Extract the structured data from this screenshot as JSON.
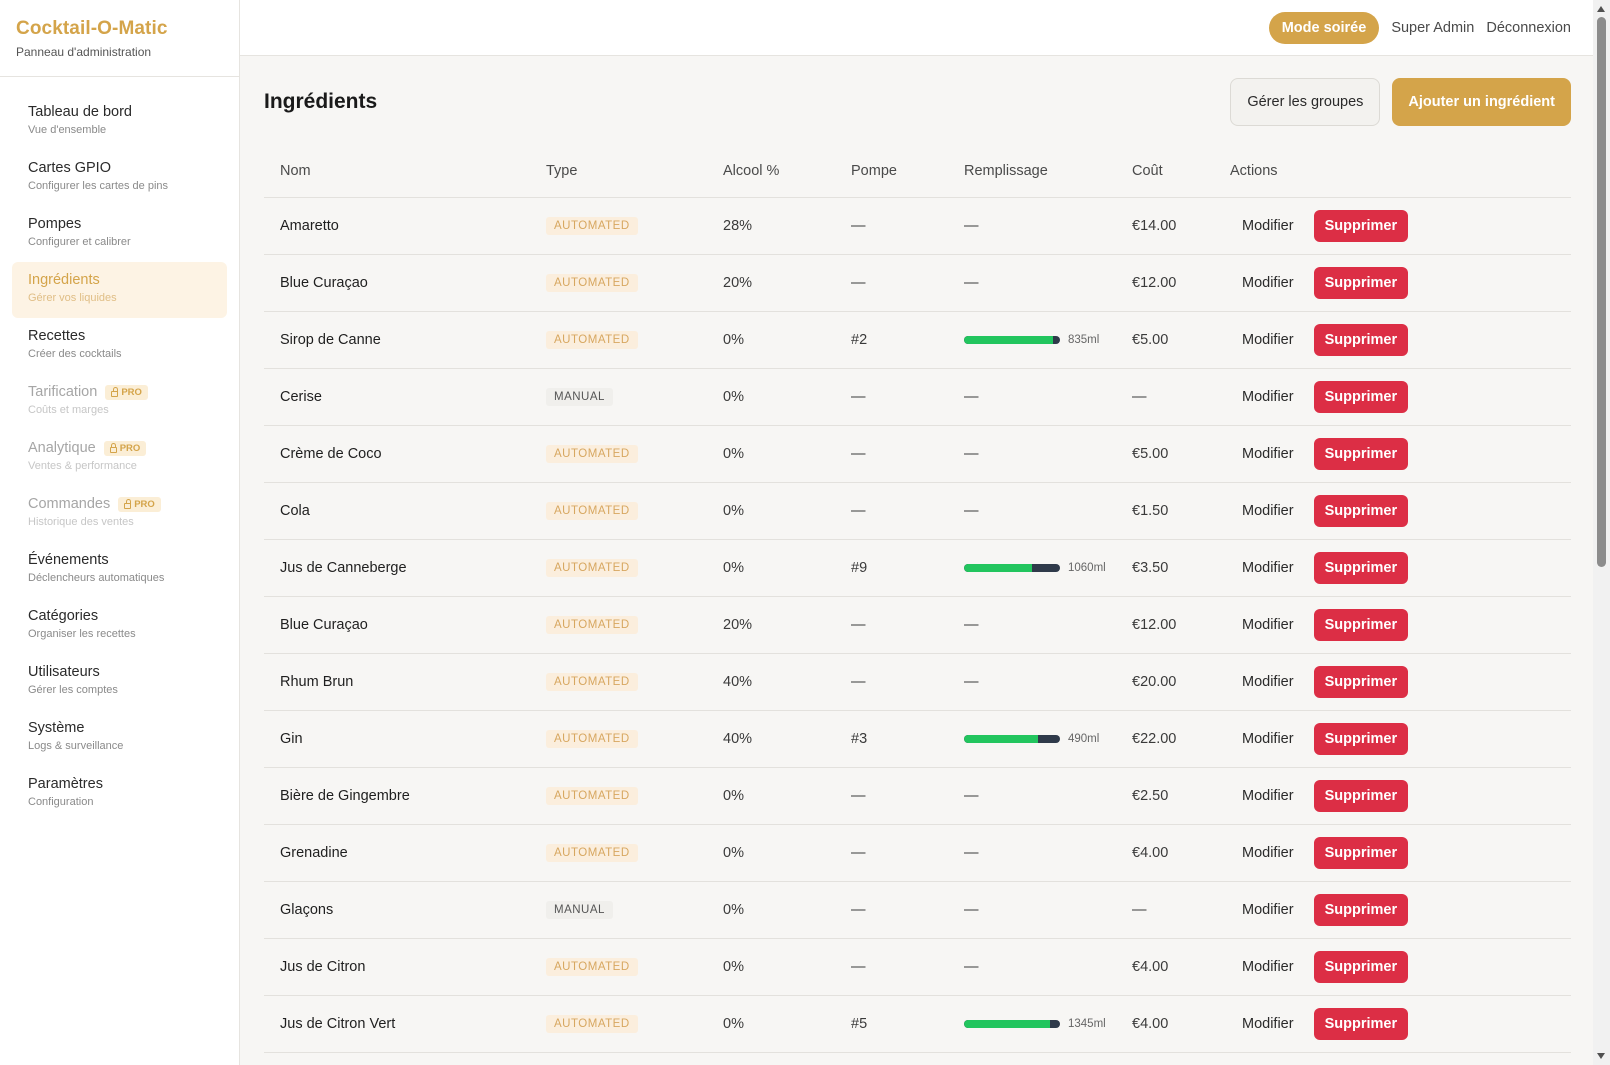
{
  "brand": {
    "title": "Cocktail-O-Matic",
    "subtitle": "Panneau d'administration"
  },
  "topbar": {
    "mode_label": "Mode soirée",
    "user_label": "Super Admin",
    "logout_label": "Déconnexion"
  },
  "sidebar": {
    "items": [
      {
        "label": "Tableau de bord",
        "sub": "Vue d'ensemble"
      },
      {
        "label": "Cartes GPIO",
        "sub": "Configurer les cartes de pins"
      },
      {
        "label": "Pompes",
        "sub": "Configurer et calibrer"
      },
      {
        "label": "Ingrédients",
        "sub": "Gérer vos liquides"
      },
      {
        "label": "Recettes",
        "sub": "Créer des cocktails"
      },
      {
        "label": "Tarification",
        "sub": "Coûts et marges",
        "badge": "PRO"
      },
      {
        "label": "Analytique",
        "sub": "Ventes & performance",
        "badge": "PRO"
      },
      {
        "label": "Commandes",
        "sub": "Historique des ventes",
        "badge": "PRO"
      },
      {
        "label": "Événements",
        "sub": "Déclencheurs automatiques"
      },
      {
        "label": "Catégories",
        "sub": "Organiser les recettes"
      },
      {
        "label": "Utilisateurs",
        "sub": "Gérer les comptes"
      },
      {
        "label": "Système",
        "sub": "Logs & surveillance"
      },
      {
        "label": "Paramètres",
        "sub": "Configuration"
      }
    ]
  },
  "page": {
    "title": "Ingrédients",
    "manage_groups_label": "Gérer les groupes",
    "add_label": "Ajouter un ingrédient"
  },
  "colors": {
    "accent": "#d4a44a",
    "danger": "#dc2e45",
    "fill_green": "#22c55e",
    "fill_track": "#2f3a4a"
  },
  "table": {
    "headers": [
      "Nom",
      "Type",
      "Alcool %",
      "Pompe",
      "Remplissage",
      "Coût",
      "Actions"
    ],
    "edit_label": "Modifier",
    "delete_label": "Supprimer",
    "rows": [
      {
        "name": "Amaretto",
        "type": "AUTOMATED",
        "alcohol": "28%",
        "pump": "—",
        "fill": "—",
        "cost": "€14.00"
      },
      {
        "name": "Blue Curaçao",
        "type": "AUTOMATED",
        "alcohol": "20%",
        "pump": "—",
        "fill": "—",
        "cost": "€12.00"
      },
      {
        "name": "Sirop de Canne",
        "type": "AUTOMATED",
        "alcohol": "0%",
        "pump": "#2",
        "fill": "835ml",
        "fill_level": 0.93,
        "cost": "€5.00"
      },
      {
        "name": "Cerise",
        "type": "MANUAL",
        "alcohol": "0%",
        "pump": "—",
        "fill": "—",
        "cost": "—"
      },
      {
        "name": "Crème de Coco",
        "type": "AUTOMATED",
        "alcohol": "0%",
        "pump": "—",
        "fill": "—",
        "cost": "€5.00"
      },
      {
        "name": "Cola",
        "type": "AUTOMATED",
        "alcohol": "0%",
        "pump": "—",
        "fill": "—",
        "cost": "€1.50"
      },
      {
        "name": "Jus de Canneberge",
        "type": "AUTOMATED",
        "alcohol": "0%",
        "pump": "#9",
        "fill": "1060ml",
        "fill_level": 0.71,
        "cost": "€3.50"
      },
      {
        "name": "Blue Curaçao",
        "type": "AUTOMATED",
        "alcohol": "20%",
        "pump": "—",
        "fill": "—",
        "cost": "€12.00"
      },
      {
        "name": "Rhum Brun",
        "type": "AUTOMATED",
        "alcohol": "40%",
        "pump": "—",
        "fill": "—",
        "cost": "€20.00"
      },
      {
        "name": "Gin",
        "type": "AUTOMATED",
        "alcohol": "40%",
        "pump": "#3",
        "fill": "490ml",
        "fill_level": 0.77,
        "cost": "€22.00"
      },
      {
        "name": "Bière de Gingembre",
        "type": "AUTOMATED",
        "alcohol": "0%",
        "pump": "—",
        "fill": "—",
        "cost": "€2.50"
      },
      {
        "name": "Grenadine",
        "type": "AUTOMATED",
        "alcohol": "0%",
        "pump": "—",
        "fill": "—",
        "cost": "€4.00"
      },
      {
        "name": "Glaçons",
        "type": "MANUAL",
        "alcohol": "0%",
        "pump": "—",
        "fill": "—",
        "cost": "—"
      },
      {
        "name": "Jus de Citron",
        "type": "AUTOMATED",
        "alcohol": "0%",
        "pump": "—",
        "fill": "—",
        "cost": "€4.00"
      },
      {
        "name": "Jus de Citron Vert",
        "type": "AUTOMATED",
        "alcohol": "0%",
        "pump": "#5",
        "fill": "1345ml",
        "fill_level": 0.9,
        "cost": "€4.00"
      }
    ]
  }
}
